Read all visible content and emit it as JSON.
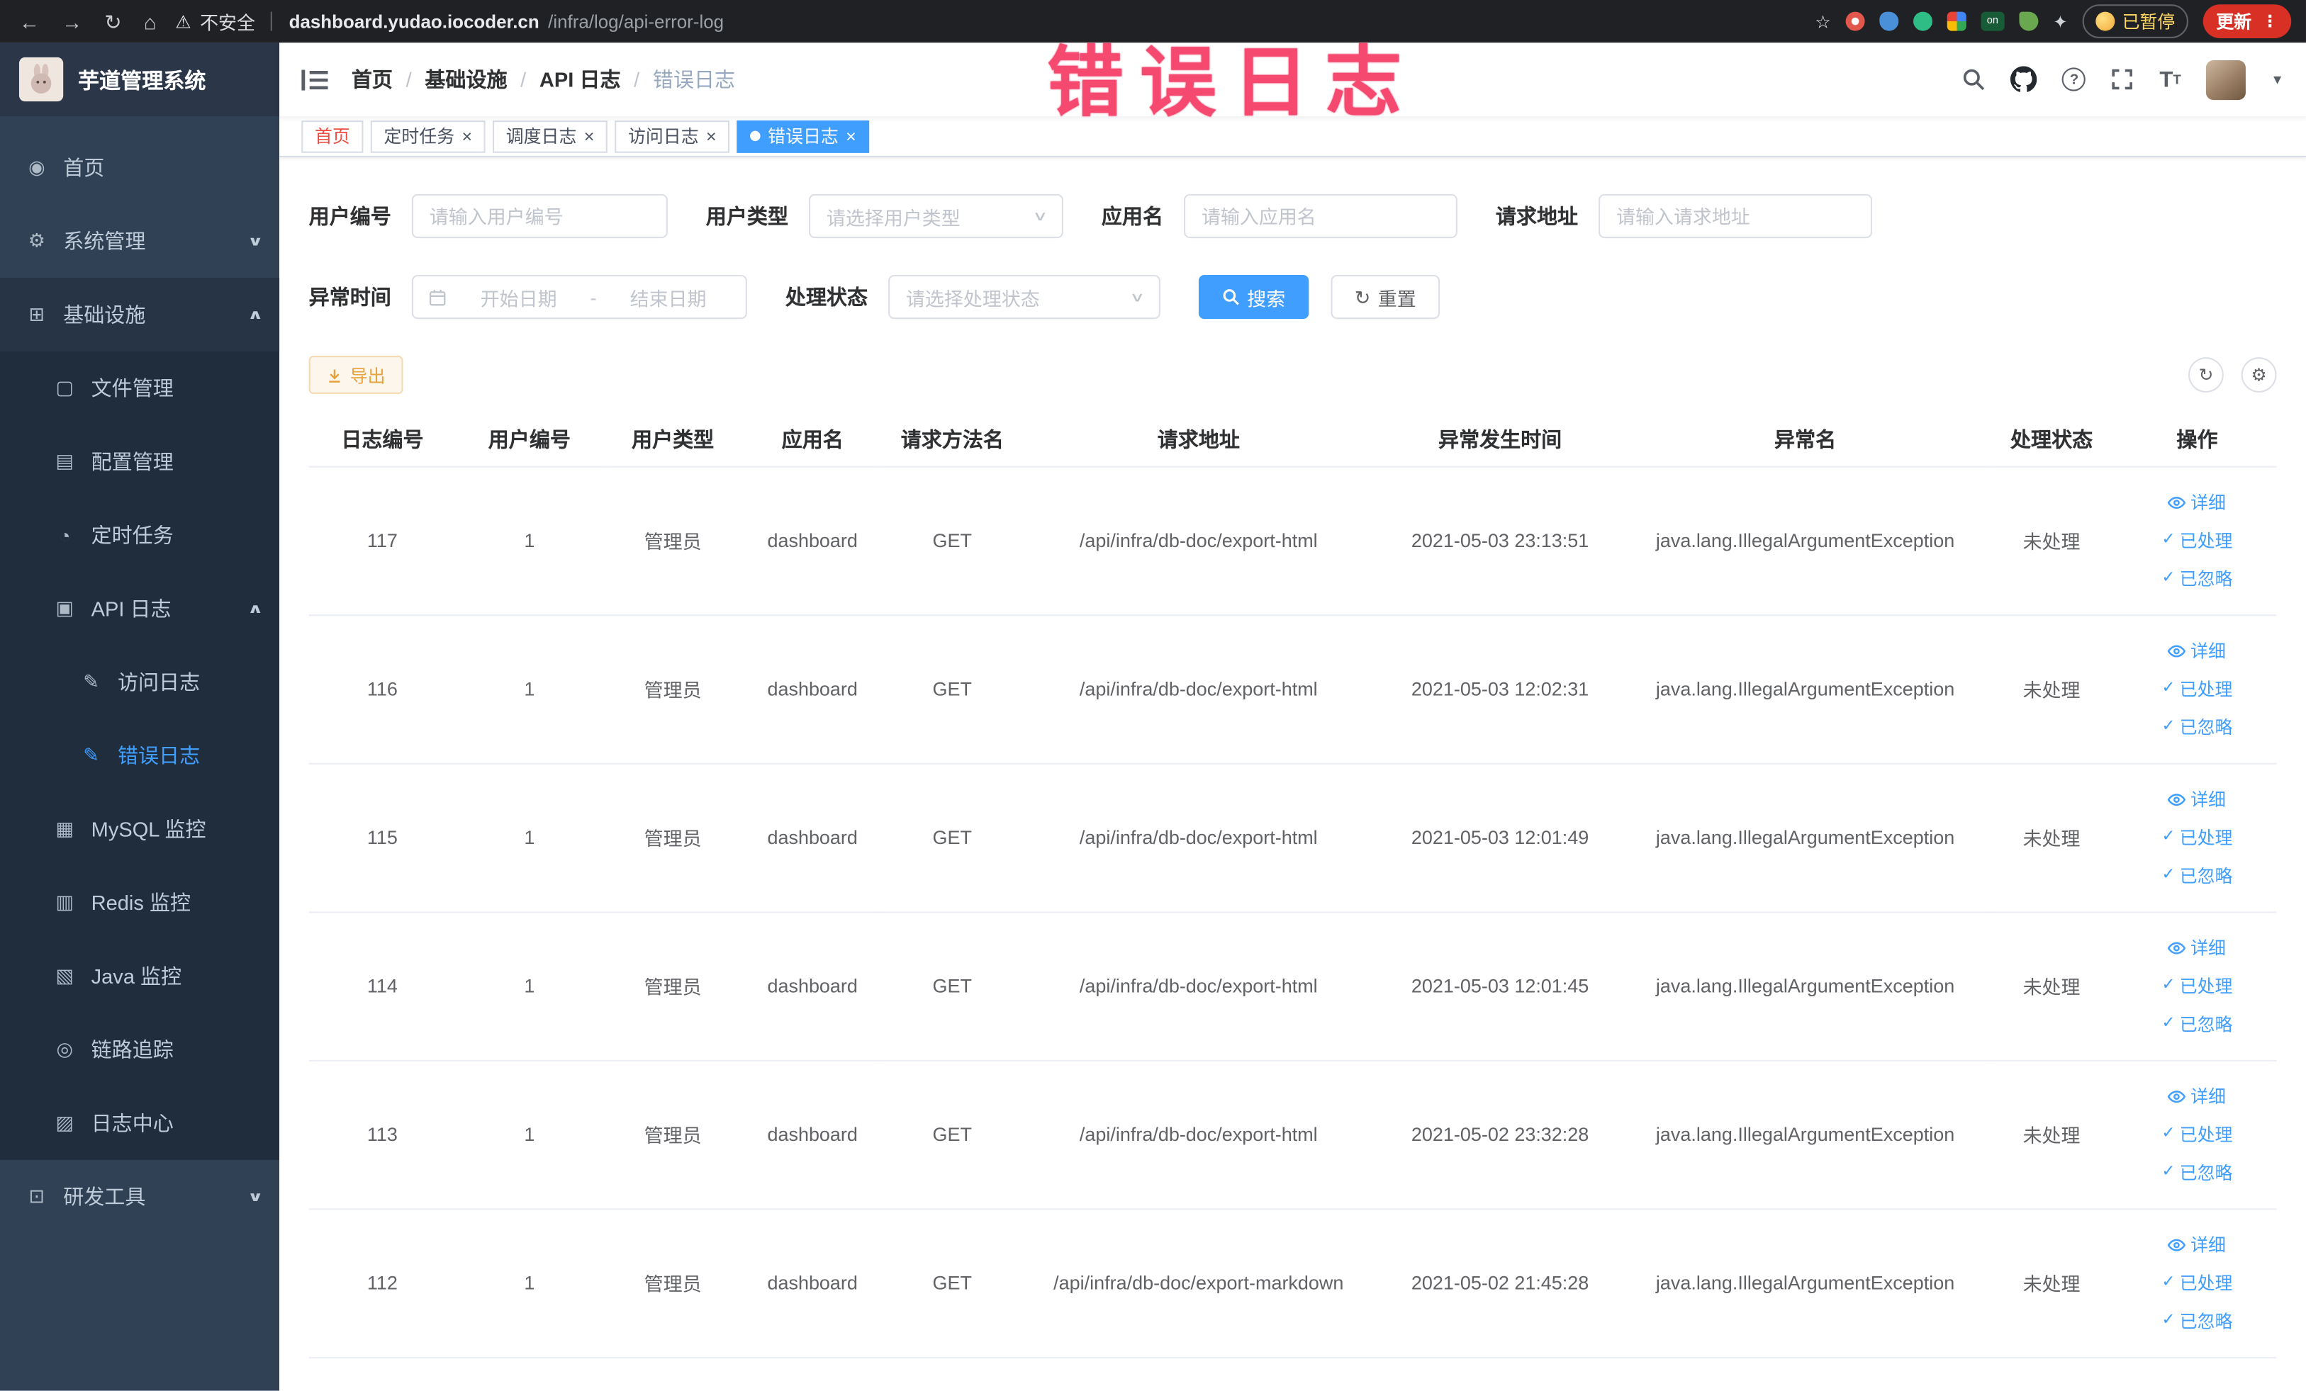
{
  "browser": {
    "not_secure": "不安全",
    "url_host": "dashboard.yudao.iocoder.cn",
    "url_path": "/infra/log/api-error-log",
    "paused_badge": "已暂停",
    "update_label": "更新"
  },
  "annotation": {
    "text": "错误日志"
  },
  "sidebar": {
    "logo_title": "芋道管理系统",
    "menu": {
      "home": "首页",
      "system": "系统管理",
      "infra": "基础设施",
      "file_manage": "文件管理",
      "config_manage": "配置管理",
      "scheduled_jobs": "定时任务",
      "api_log": "API 日志",
      "access_log": "访问日志",
      "error_log": "错误日志",
      "mysql_monitor": "MySQL 监控",
      "redis_monitor": "Redis 监控",
      "java_monitor": "Java 监控",
      "trace": "链路追踪",
      "log_center": "日志中心",
      "dev_tools": "研发工具"
    }
  },
  "header": {
    "breadcrumb": [
      "首页",
      "基础设施",
      "API 日志",
      "错误日志"
    ]
  },
  "tabs": [
    {
      "label": "首页"
    },
    {
      "label": "定时任务"
    },
    {
      "label": "调度日志"
    },
    {
      "label": "访问日志"
    },
    {
      "label": "错误日志"
    }
  ],
  "filters": {
    "user_id_label": "用户编号",
    "user_id_placeholder": "请输入用户编号",
    "user_type_label": "用户类型",
    "user_type_placeholder": "请选择用户类型",
    "app_name_label": "应用名",
    "app_name_placeholder": "请输入应用名",
    "request_url_label": "请求地址",
    "request_url_placeholder": "请输入请求地址",
    "exception_time_label": "异常时间",
    "start_date_placeholder": "开始日期",
    "range_separator": "-",
    "end_date_placeholder": "结束日期",
    "process_status_label": "处理状态",
    "process_status_placeholder": "请选择处理状态",
    "search_label": "搜索",
    "reset_label": "重置"
  },
  "toolbar": {
    "export_label": "导出"
  },
  "table": {
    "columns": [
      "日志编号",
      "用户编号",
      "用户类型",
      "应用名",
      "请求方法名",
      "请求地址",
      "异常发生时间",
      "异常名",
      "处理状态",
      "操作"
    ],
    "actions": {
      "detail": "详细",
      "processed": "已处理",
      "ignored": "已忽略"
    },
    "rows": [
      {
        "id": "117",
        "user_id": "1",
        "user_type": "管理员",
        "app": "dashboard",
        "method": "GET",
        "url": "/api/infra/db-doc/export-html",
        "time": "2021-05-03 23:13:51",
        "exception": "java.lang.IllegalArgumentException",
        "status": "未处理"
      },
      {
        "id": "116",
        "user_id": "1",
        "user_type": "管理员",
        "app": "dashboard",
        "method": "GET",
        "url": "/api/infra/db-doc/export-html",
        "time": "2021-05-03 12:02:31",
        "exception": "java.lang.IllegalArgumentException",
        "status": "未处理"
      },
      {
        "id": "115",
        "user_id": "1",
        "user_type": "管理员",
        "app": "dashboard",
        "method": "GET",
        "url": "/api/infra/db-doc/export-html",
        "time": "2021-05-03 12:01:49",
        "exception": "java.lang.IllegalArgumentException",
        "status": "未处理"
      },
      {
        "id": "114",
        "user_id": "1",
        "user_type": "管理员",
        "app": "dashboard",
        "method": "GET",
        "url": "/api/infra/db-doc/export-html",
        "time": "2021-05-03 12:01:45",
        "exception": "java.lang.IllegalArgumentException",
        "status": "未处理"
      },
      {
        "id": "113",
        "user_id": "1",
        "user_type": "管理员",
        "app": "dashboard",
        "method": "GET",
        "url": "/api/infra/db-doc/export-html",
        "time": "2021-05-02 23:32:28",
        "exception": "java.lang.IllegalArgumentException",
        "status": "未处理"
      },
      {
        "id": "112",
        "user_id": "1",
        "user_type": "管理员",
        "app": "dashboard",
        "method": "GET",
        "url": "/api/infra/db-doc/export-markdown",
        "time": "2021-05-02 21:45:28",
        "exception": "java.lang.IllegalArgumentException",
        "status": "未处理"
      }
    ]
  }
}
